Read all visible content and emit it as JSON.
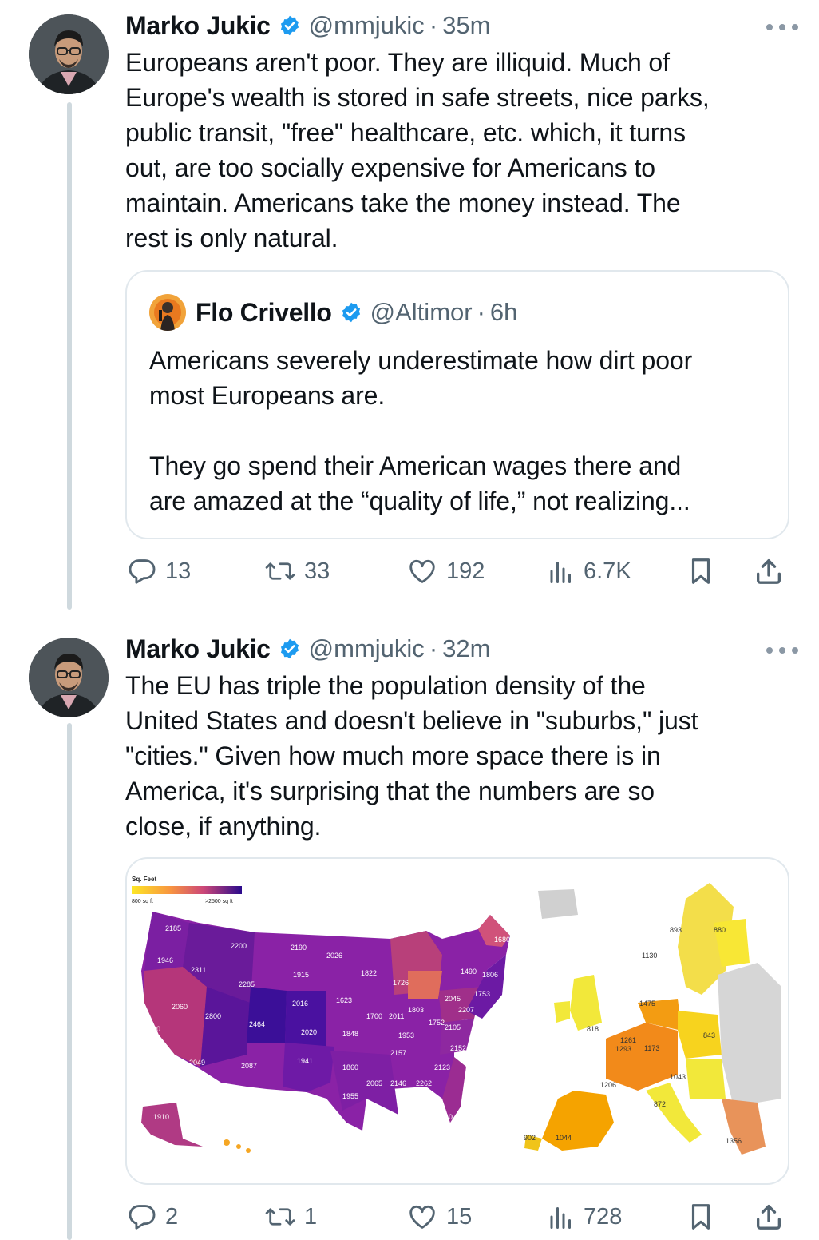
{
  "tweets": [
    {
      "author": {
        "name": "Marko Jukic",
        "handle": "@mmjukic"
      },
      "time": "35m",
      "separator": "·",
      "text": "Europeans aren't poor. They are illiquid. Much of\nEurope's wealth is stored in safe streets, nice parks,\npublic transit, \"free\" healthcare, etc. which, it turns\nout, are too socially expensive for Americans to\nmaintain. Americans take the money instead. The\nrest is only natural.",
      "quote": {
        "author": {
          "name": "Flo Crivello",
          "handle": "@Altimor"
        },
        "time": "6h",
        "text": "Americans severely underestimate how dirt poor\nmost Europeans are.\n\nThey go spend their American wages there and\nare amazed at the “quality of life,” not realizing..."
      },
      "stats": {
        "replies": "13",
        "reposts": "33",
        "likes": "192",
        "views": "6.7K"
      }
    },
    {
      "author": {
        "name": "Marko Jukic",
        "handle": "@mmjukic"
      },
      "time": "32m",
      "separator": "·",
      "text": "The EU has triple the population density of the\nUnited States and doesn't believe in \"suburbs,\" just\n\"cities.\" Given how much more space there is in\nAmerica, it's surprising that the numbers are so\nclose, if anything.",
      "stats": {
        "replies": "2",
        "reposts": "1",
        "likes": "15",
        "views": "728"
      }
    }
  ],
  "map": {
    "legend_title": "Sq. Feet",
    "legend_min": "800 sq ft",
    "legend_max": ">2500 sq ft",
    "us_labels": [
      "2185",
      "1946",
      "2311",
      "2200",
      "2190",
      "2026",
      "1680",
      "1915",
      "1822",
      "1726",
      "1490",
      "1806",
      "2285",
      "1623",
      "2045",
      "1753",
      "2060",
      "2800",
      "2464",
      "2016",
      "1700",
      "2011",
      "1803",
      "2207",
      "1752",
      "2105",
      "1860",
      "2020",
      "1848",
      "1953",
      "2152",
      "2157",
      "2049",
      "2087",
      "1941",
      "1860",
      "2123",
      "2065",
      "2146",
      "2262",
      "1955",
      "2170",
      "1960",
      "1910",
      "1164"
    ],
    "eu_labels": [
      "893",
      "880",
      "1130",
      "1475",
      "818",
      "843",
      "1261",
      "1293",
      "1173",
      "1206",
      "1043",
      "872",
      "902",
      "1044",
      "1356"
    ]
  },
  "colors": {
    "verified": "#1d9bf0",
    "text_secondary": "#536471",
    "thread_line": "#cfd9de"
  },
  "icons": {
    "reply": "reply-icon",
    "repost": "repost-icon",
    "like": "like-icon",
    "views": "views-icon",
    "bookmark": "bookmark-icon",
    "share": "share-icon",
    "more": "more-icon",
    "verified": "verified-icon"
  }
}
